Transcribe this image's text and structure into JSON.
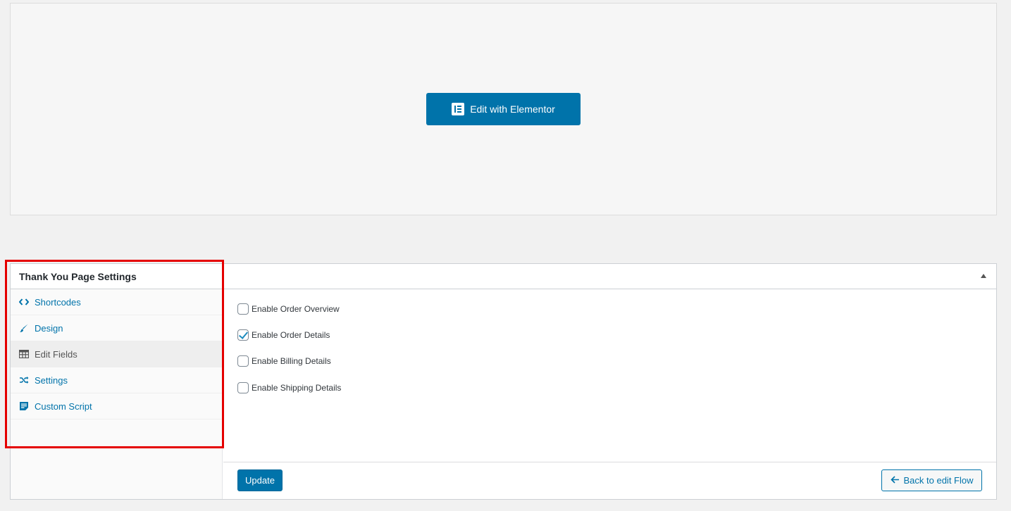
{
  "elementor": {
    "button_label": "Edit with Elementor",
    "icon": "elementor-icon"
  },
  "panel": {
    "title": "Thank You Page Settings",
    "toggle_icon": "triangle-up-icon"
  },
  "sidebar": {
    "items": [
      {
        "label": "Shortcodes",
        "icon": "code-icon"
      },
      {
        "label": "Design",
        "icon": "brush-icon"
      },
      {
        "label": "Edit Fields",
        "icon": "table-icon",
        "active": true
      },
      {
        "label": "Settings",
        "icon": "shuffle-icon"
      },
      {
        "label": "Custom Script",
        "icon": "text-page-icon"
      }
    ]
  },
  "fields": [
    {
      "label": "Enable Order Overview",
      "checked": false
    },
    {
      "label": "Enable Order Details",
      "checked": true
    },
    {
      "label": "Enable Billing Details",
      "checked": false
    },
    {
      "label": "Enable Shipping Details",
      "checked": false
    }
  ],
  "footer": {
    "update_label": "Update",
    "back_label": "Back to edit Flow",
    "back_icon": "arrow-left-icon"
  },
  "colors": {
    "primary": "#0073aa",
    "highlight": "#e50000"
  }
}
